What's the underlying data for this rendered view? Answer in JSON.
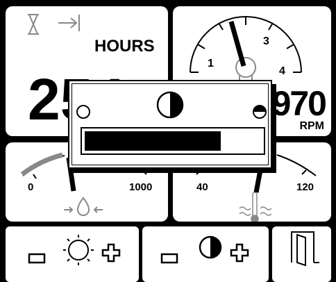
{
  "hours_panel": {
    "unit_label": "HOURS",
    "value": "254",
    "icons": [
      "hourglass-icon",
      "arrow-to-bar-icon"
    ]
  },
  "rpm_panel": {
    "scale_labels": [
      "1",
      "3",
      "4"
    ],
    "value": "970",
    "unit_label": "RPM",
    "icons": [
      "engine-icon"
    ]
  },
  "oil_pressure_panel": {
    "scale_min": "0",
    "scale_max": "1000",
    "icons": [
      "oil-pressure-icon"
    ]
  },
  "coolant_temp_panel": {
    "scale_min": "40",
    "scale_max": "120",
    "icons": [
      "coolant-temperature-icon"
    ]
  },
  "brightness_dialog": {
    "icons": [
      "contrast-icon",
      "min-brightness-icon",
      "max-brightness-icon"
    ],
    "level": 0.77
  },
  "footer": {
    "buttons": [
      {
        "name": "backlight",
        "icons": [
          "minus-icon",
          "sun-icon",
          "plus-icon"
        ]
      },
      {
        "name": "contrast",
        "icons": [
          "minus-icon",
          "contrast-icon",
          "plus-icon"
        ]
      },
      {
        "name": "exit",
        "icons": [
          "exit-door-icon"
        ]
      }
    ]
  },
  "colors": {
    "background": "#000000",
    "panel": "#ffffff",
    "accent_gray": "#888888",
    "ink": "#000000"
  }
}
